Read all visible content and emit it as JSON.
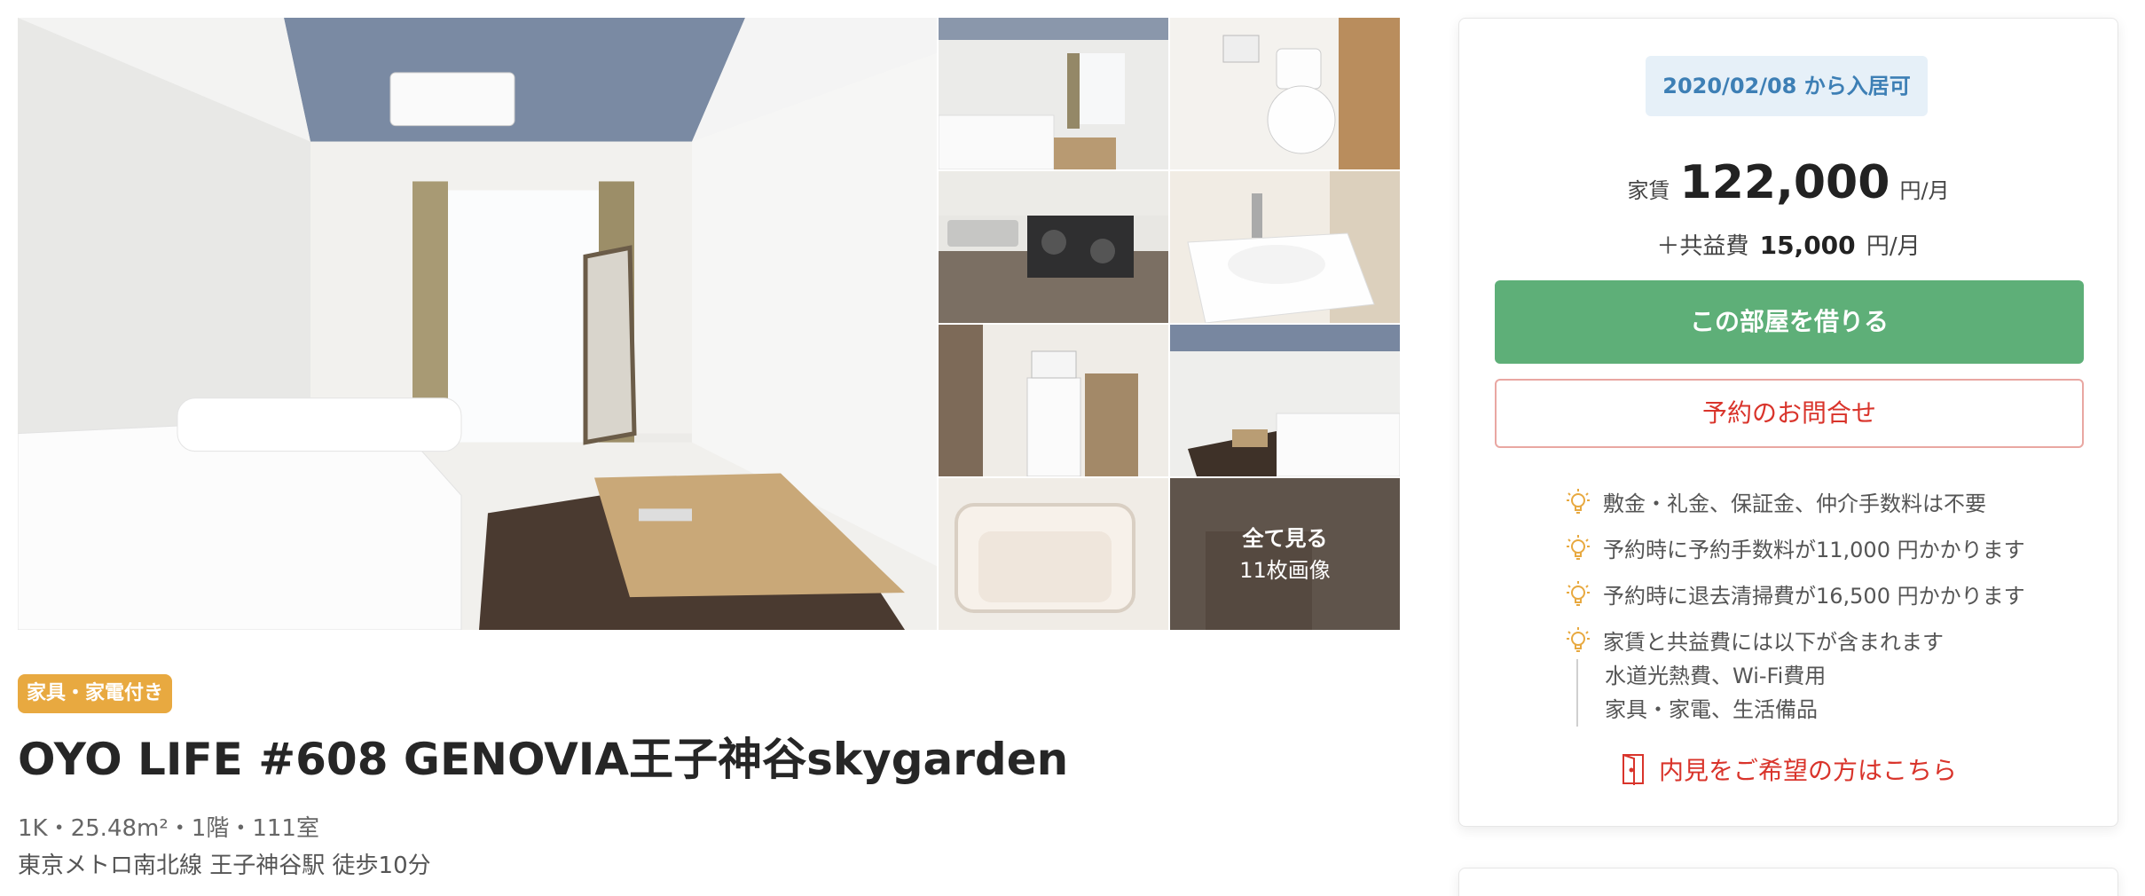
{
  "gallery": {
    "see_all_label": "全て見る",
    "image_count_label": "11枚画像"
  },
  "listing": {
    "badge": "家具・家電付き",
    "title": "OYO LIFE #608 GENOVIA王子神谷skygarden",
    "specs": "1K・25.48m²・1階・111室",
    "access": "東京メトロ南北線 王子神谷駅 徒歩10分"
  },
  "card": {
    "move_in": "2020/02/08 から入居可",
    "rent_label": "家賃",
    "rent_amount": "122,000",
    "rent_unit": "円/月",
    "common_label": "＋共益費",
    "common_amount": "15,000",
    "common_unit": "円/月",
    "rent_button": "この部屋を借りる",
    "inquiry_button": "予約のお問合せ",
    "notes": [
      "敷金・礼金、保証金、仲介手数料は不要",
      "予約時に予約手数料が11,000 円かかります",
      "予約時に退去清掃費が16,500 円かかります",
      "家賃と共益費には以下が含まれます"
    ],
    "included": [
      "水道光熱費、Wi-Fi費用",
      "家具・家電、生活備品"
    ],
    "viewing_link": "内見をご希望の方はこちら"
  },
  "icons": {
    "note": "lightbulb-icon",
    "viewing": "door-icon"
  },
  "colors": {
    "badge": "#e8a940",
    "rent_button": "#5eaf78",
    "inquiry": "#d9342b",
    "move_in_bg": "#e6f0f8",
    "move_in_text": "#3d7fb5"
  }
}
